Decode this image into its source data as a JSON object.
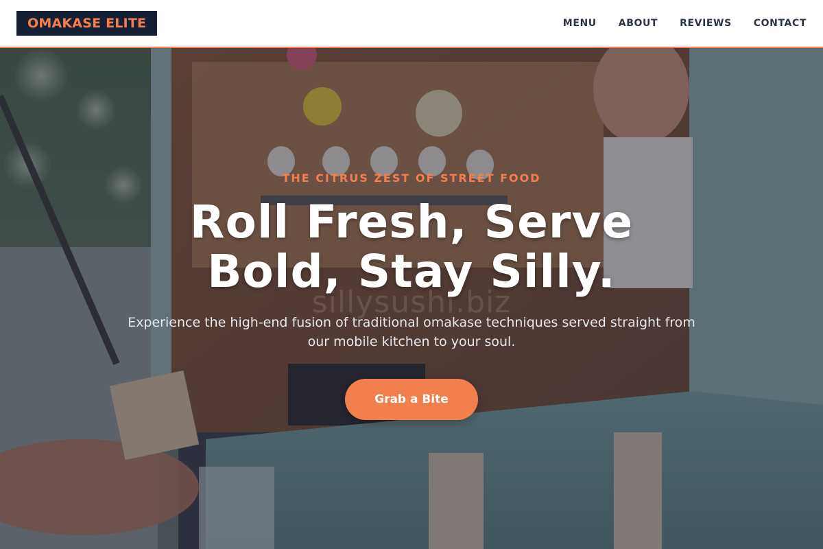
{
  "brand": {
    "logo_text": "OMAKASE ELITE"
  },
  "nav": {
    "items": [
      {
        "label": "MENU"
      },
      {
        "label": "ABOUT"
      },
      {
        "label": "REVIEWS"
      },
      {
        "label": "CONTACT"
      }
    ]
  },
  "hero": {
    "eyebrow": "THE CITRUS ZEST OF STREET FOOD",
    "headline": "Roll Fresh, Serve Bold, Stay Silly.",
    "subtext": "Experience the high-end fusion of traditional omakase techniques served straight from our mobile kitchen to your soul.",
    "cta_label": "Grab a Bite",
    "watermark": "sillysushi.biz"
  },
  "colors": {
    "accent": "#f37f4f",
    "logo_bg": "#162035",
    "nav_text": "#2b3447",
    "overlay": "#1e2030"
  }
}
